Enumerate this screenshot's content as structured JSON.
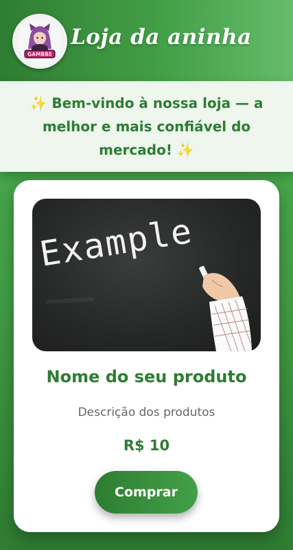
{
  "header": {
    "brand_name": "Loja da aninha",
    "logo_icon": "anime-girl-logo-icon",
    "logo_text": "GAMBBE"
  },
  "banner": {
    "text": "✨ Bem-vindo à nossa loja — a melhor e mais confiável do mercado! ✨"
  },
  "product": {
    "image_text": "Example",
    "name": "Nome do seu produto",
    "description": "Descrição dos produtos",
    "price": "R$ 10",
    "buy_label": "Comprar"
  },
  "colors": {
    "primary_green": "#2e7d32",
    "accent_green": "#43a047",
    "banner_bg": "#eef6ee",
    "card_bg": "#ffffff"
  }
}
